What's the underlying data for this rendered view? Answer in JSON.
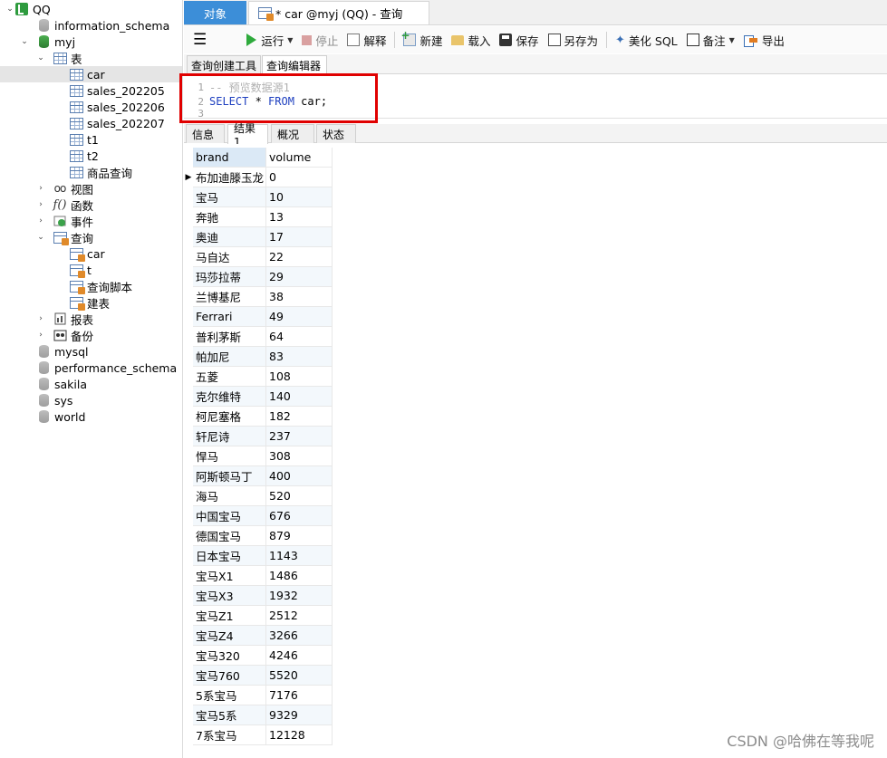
{
  "sidebar": {
    "connection": "QQ",
    "databases_top": [
      "information_schema"
    ],
    "active_db": "myj",
    "tables_group": "表",
    "tables": [
      "car",
      "sales_202205",
      "sales_202206",
      "sales_202207",
      "t1",
      "t2",
      "商品查询"
    ],
    "views": "视图",
    "functions": "函数",
    "events": "事件",
    "queries_group": "查询",
    "queries": [
      "car",
      "t",
      "查询脚本",
      "建表"
    ],
    "reports": "报表",
    "backups": "备份",
    "databases_bottom": [
      "mysql",
      "performance_schema",
      "sakila",
      "sys",
      "world"
    ]
  },
  "tabs": {
    "objects": "对象",
    "query": "* car @myj (QQ) - 查询"
  },
  "toolbar": {
    "run": "运行",
    "stop": "停止",
    "explain": "解释",
    "new": "新建",
    "load": "载入",
    "save": "保存",
    "save_as": "另存为",
    "beautify": "美化 SQL",
    "note": "备注",
    "export": "导出"
  },
  "subtabs": {
    "builder": "查询创建工具",
    "editor": "查询编辑器"
  },
  "editor": {
    "lines": [
      {
        "num": "1",
        "comment": "-- 预览数据源1"
      },
      {
        "num": "2",
        "kw1": "SELECT",
        "mid": " * ",
        "kw2": "FROM",
        "rest": " car;"
      },
      {
        "num": "3"
      }
    ]
  },
  "result_tabs": [
    "信息",
    "结果1",
    "概况",
    "状态"
  ],
  "grid": {
    "columns": [
      "brand",
      "volume"
    ],
    "rows": [
      [
        "布加迪滕玉龙",
        "0"
      ],
      [
        "宝马",
        "10"
      ],
      [
        "奔驰",
        "13"
      ],
      [
        "奥迪",
        "17"
      ],
      [
        "马自达",
        "22"
      ],
      [
        "玛莎拉蒂",
        "29"
      ],
      [
        "兰博基尼",
        "38"
      ],
      [
        "Ferrari",
        "49"
      ],
      [
        "普利茅斯",
        "64"
      ],
      [
        "帕加尼",
        "83"
      ],
      [
        "五菱",
        "108"
      ],
      [
        "克尔维特",
        "140"
      ],
      [
        "柯尼塞格",
        "182"
      ],
      [
        "轩尼诗",
        "237"
      ],
      [
        "悍马",
        "308"
      ],
      [
        "阿斯顿马丁",
        "400"
      ],
      [
        "海马",
        "520"
      ],
      [
        "中国宝马",
        "676"
      ],
      [
        "德国宝马",
        "879"
      ],
      [
        "日本宝马",
        "1143"
      ],
      [
        "宝马X1",
        "1486"
      ],
      [
        "宝马X3",
        "1932"
      ],
      [
        "宝马Z1",
        "2512"
      ],
      [
        "宝马Z4",
        "3266"
      ],
      [
        "宝马320",
        "4246"
      ],
      [
        "宝马760",
        "5520"
      ],
      [
        "5系宝马",
        "7176"
      ],
      [
        "宝马5系",
        "9329"
      ],
      [
        "7系宝马",
        "12128"
      ]
    ]
  },
  "watermark": "CSDN @哈佛在等我呢"
}
